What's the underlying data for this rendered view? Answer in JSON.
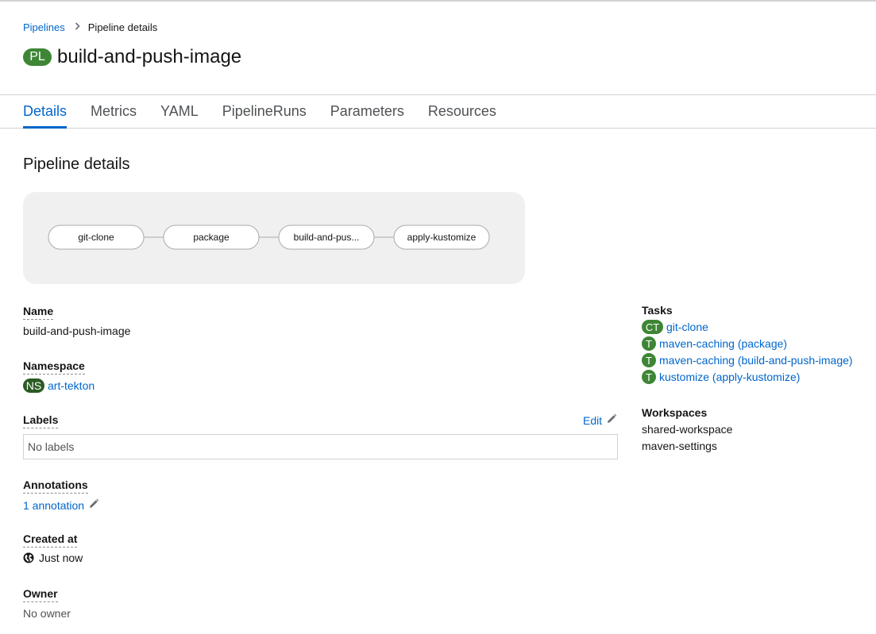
{
  "breadcrumb": {
    "parent": "Pipelines",
    "current": "Pipeline details"
  },
  "header": {
    "badge": "PL",
    "title": "build-and-push-image"
  },
  "tabs": [
    {
      "label": "Details",
      "active": true
    },
    {
      "label": "Metrics"
    },
    {
      "label": "YAML"
    },
    {
      "label": "PipelineRuns"
    },
    {
      "label": "Parameters"
    },
    {
      "label": "Resources"
    }
  ],
  "section_title": "Pipeline details",
  "topology": {
    "nodes": [
      "git-clone",
      "package",
      "build-and-pus...",
      "apply-kustomize"
    ]
  },
  "details": {
    "name_label": "Name",
    "name_value": "build-and-push-image",
    "namespace_label": "Namespace",
    "namespace_badge": "NS",
    "namespace_value": "art-tekton",
    "labels_label": "Labels",
    "labels_edit": "Edit",
    "labels_value": "No labels",
    "annotations_label": "Annotations",
    "annotations_value": "1 annotation",
    "created_label": "Created at",
    "created_value": "Just now",
    "owner_label": "Owner",
    "owner_value": "No owner"
  },
  "tasks": {
    "label": "Tasks",
    "items": [
      {
        "badge": "CT",
        "name": "git-clone"
      },
      {
        "badge": "T",
        "name": "maven-caching (package)"
      },
      {
        "badge": "T",
        "name": "maven-caching (build-and-push-image)"
      },
      {
        "badge": "T",
        "name": "kustomize (apply-kustomize)"
      }
    ]
  },
  "workspaces": {
    "label": "Workspaces",
    "items": [
      "shared-workspace",
      "maven-settings"
    ]
  },
  "colors": {
    "accent": "#0066cc",
    "badge_green": "#3e8635",
    "badge_dark": "#2b5b23"
  },
  "icons": {
    "breadcrumb_separator": "chevron-right-icon",
    "edit": "pencil-icon",
    "created": "globe-icon"
  }
}
